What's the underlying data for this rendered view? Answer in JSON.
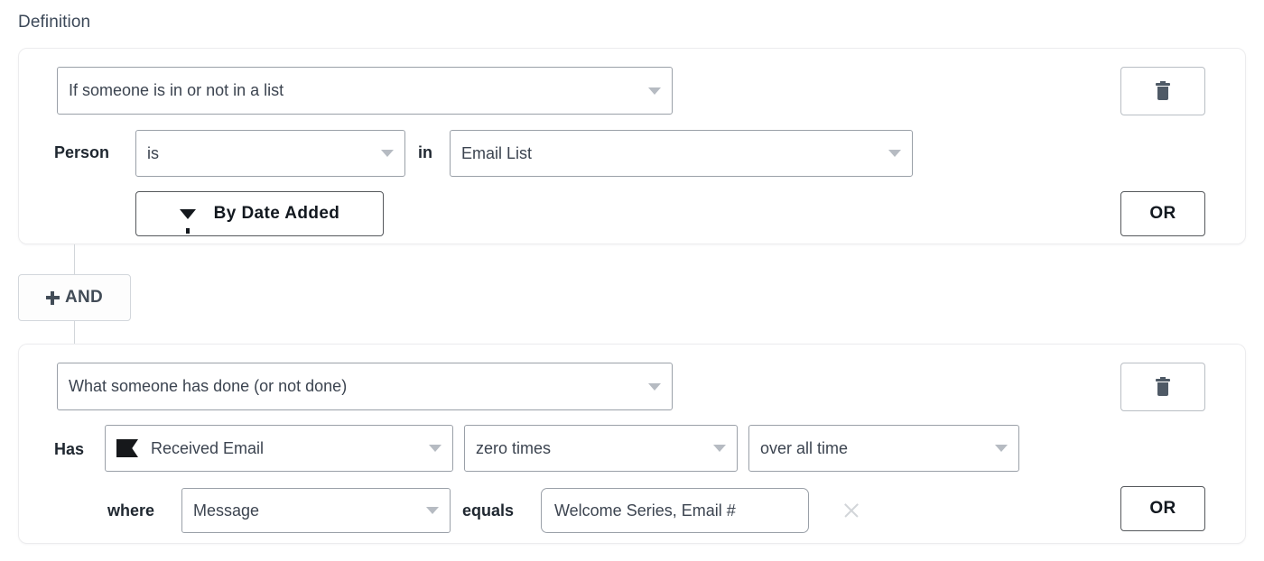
{
  "page": {
    "section_title": "Definition"
  },
  "condition_blocks": [
    {
      "type_select": {
        "value": "If someone is in or not in a list",
        "icon": "chevron-down-icon"
      },
      "delete_button": {
        "icon": "trash-icon"
      },
      "row": {
        "subject_label": "Person",
        "operator_select": {
          "value": "is",
          "icon": "chevron-down-icon"
        },
        "joiner_label": "in",
        "target_select": {
          "value": "Email List",
          "icon": "chevron-down-icon"
        }
      },
      "filter_button": {
        "label": "By Date Added",
        "icon": "filter-icon"
      },
      "or_button": {
        "label": "OR"
      }
    },
    {
      "type_select": {
        "value": "What someone has done (or not done)",
        "icon": "chevron-down-icon"
      },
      "delete_button": {
        "icon": "trash-icon"
      },
      "row": {
        "subject_label": "Has",
        "metric_select": {
          "value": "Received Email",
          "icon": "flag-icon"
        },
        "count_select": {
          "value": "zero times",
          "icon": "chevron-down-icon"
        },
        "timeframe_select": {
          "value": "over all time",
          "icon": "chevron-down-icon"
        }
      },
      "filter_row": {
        "where_label": "where",
        "property_select": {
          "value": "Message",
          "icon": "chevron-down-icon"
        },
        "comparator_label": "equals",
        "value_field": {
          "value": "Welcome Series, Email #",
          "placeholder": "Value"
        },
        "clear_button": {
          "icon": "close-icon"
        }
      },
      "or_button": {
        "label": "OR"
      }
    }
  ],
  "add_and_button": {
    "label": "AND",
    "icon": "plus-icon"
  },
  "colors": {
    "card_border": "#ececee",
    "control_border": "#9aa0a8",
    "text": "#3c4450",
    "label_text": "#1f2730",
    "caret": "#b6bbc2",
    "trash": "#4f5a66",
    "connector": "#d2d6da"
  }
}
